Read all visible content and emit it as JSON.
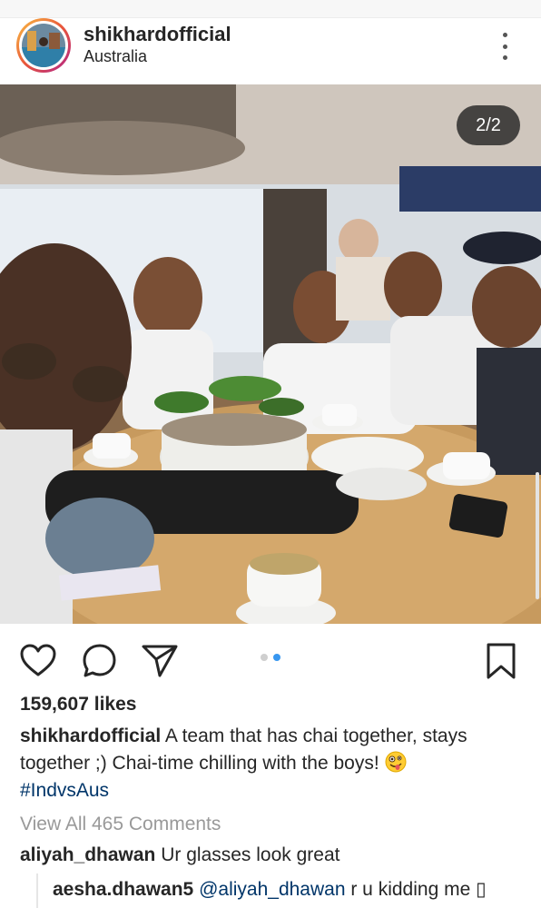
{
  "post": {
    "username": "shikhardofficial",
    "location": "Australia",
    "image_counter": "2/2",
    "icons": {
      "more": "more-vertical-icon",
      "like": "heart-icon",
      "comment": "comment-bubble-icon",
      "share": "send-icon",
      "save": "bookmark-icon"
    },
    "carousel": {
      "total": 2,
      "active": 2
    },
    "likes": "159,607 likes",
    "caption": {
      "username": "shikhardofficial",
      "text": "A team that has chai together, stays together ;) Chai-time chilling with the boys!",
      "emoji": "crazy-face-emoji",
      "hashtag": "#IndvsAus"
    },
    "view_all_comments": "View All 465 Comments",
    "comments": [
      {
        "username": "aliyah_dhawan",
        "text": "Ur glasses look great"
      }
    ],
    "reply": {
      "username": "aesha.dhawan5",
      "mention": "@aliyah_dhawan",
      "text": "r u kidding me",
      "trailing_glyph": "▯"
    },
    "colors": {
      "link": "#003569",
      "muted": "#999999",
      "active_dot": "#3897f0"
    }
  }
}
